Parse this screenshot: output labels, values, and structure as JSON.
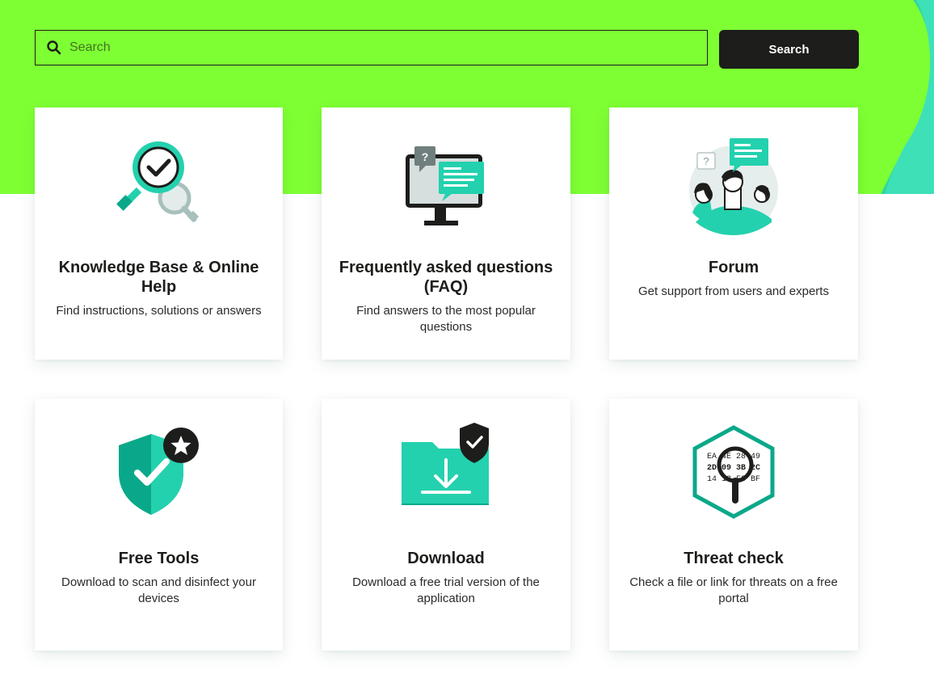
{
  "search": {
    "placeholder": "Search",
    "button_label": "Search"
  },
  "colors": {
    "brand_green": "#7eff33",
    "accent_teal": "#23d1ae",
    "dark": "#1d1d1b"
  },
  "cards": [
    {
      "icon": "magnifier-check-icon",
      "title": "Knowledge Base & Online Help",
      "description": "Find instructions, solutions or answers"
    },
    {
      "icon": "monitor-chat-icon",
      "title": "Frequently asked questions (FAQ)",
      "description": "Find answers to the most popular questions"
    },
    {
      "icon": "forum-people-icon",
      "title": "Forum",
      "description": "Get support from users and experts"
    },
    {
      "icon": "shield-star-icon",
      "title": "Free Tools",
      "description": "Download to scan and disinfect your devices"
    },
    {
      "icon": "folder-download-icon",
      "title": "Download",
      "description": "Download a free trial version of the application"
    },
    {
      "icon": "threat-check-icon",
      "title": "Threat check",
      "description": "Check a file or link for threats on a free portal",
      "hex_text": [
        "EA 4E 28 49",
        "2D 09 3B 2C",
        "14 13 F3 BF"
      ]
    }
  ]
}
